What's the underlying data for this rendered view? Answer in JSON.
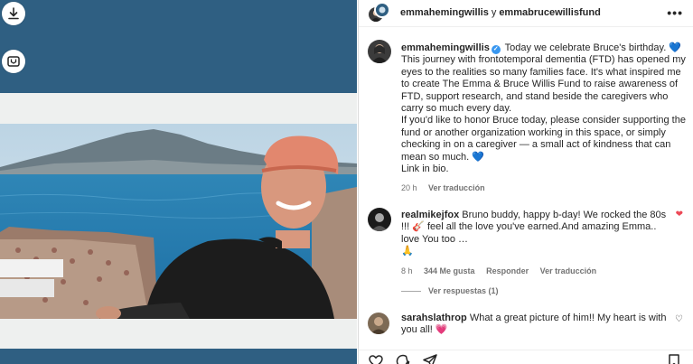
{
  "header": {
    "user1": "emmahemingwillis",
    "separator": "y",
    "user2": "emmabrucewillisfund",
    "more_label": "•••"
  },
  "caption": {
    "username": "emmahemingwillis",
    "paragraph1": "Today we celebrate Bruce's birthday. 💙 This journey with frontotemporal dementia (FTD) has opened my eyes to the realities so many families face. It's what inspired me to create The Emma & Bruce Willis Fund to raise awareness of FTD, support research, and stand beside the caregivers who carry so much every day.",
    "paragraph2": "If you'd like to honor Bruce today, please consider supporting the fund or another organization working in this space, or simply checking in on a caregiver — a small act of kindness that can mean so much. 💙",
    "paragraph3": "Link in bio.",
    "time": "20 h",
    "translate": "Ver traducción"
  },
  "comments": [
    {
      "username": "realmikejfox",
      "text": "Bruno buddy, happy b-day! We rocked the 80s !!! 🎸 feel all the love you've earned.And amazing Emma.. love You too …",
      "emoji_line": "🙏",
      "time": "8 h",
      "likes": "344 Me gusta",
      "reply": "Responder",
      "translate": "Ver traducción"
    },
    {
      "username": "sarahslathrop",
      "text": "What a great picture of him!! My heart is with you all! 💗"
    }
  ],
  "view_replies": "Ver respuestas (1)",
  "colors": {
    "media_background": "#2f5f82",
    "verified_badge": "#3897f0",
    "like_red": "#ed4956"
  },
  "icons": [
    "download-icon",
    "caption-icon",
    "more-icon",
    "heart-icon",
    "comment-icon",
    "share-icon",
    "bookmark-icon"
  ]
}
